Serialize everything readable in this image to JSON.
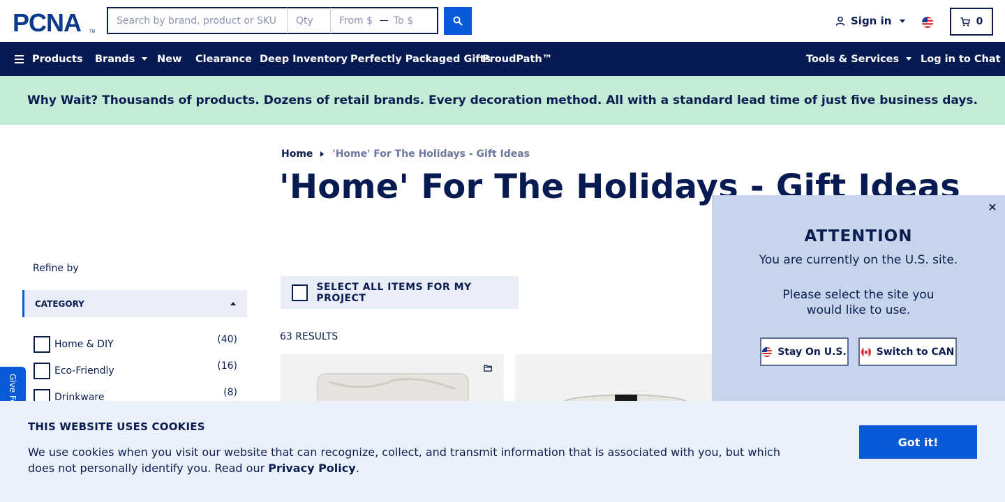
{
  "header": {
    "logo_text": "PCNA",
    "search_placeholder": "Search by brand, product or SKU",
    "qty_placeholder": "Qty",
    "price_from_placeholder": "From $",
    "price_to_placeholder": "To $",
    "sign_in_label": "Sign in",
    "cart_count": "0"
  },
  "nav": {
    "products": "Products",
    "brands": "Brands",
    "new": "New",
    "clearance": "Clearance",
    "deep_inventory": "Deep Inventory",
    "packaged_gifts": "Perfectly Packaged Gifts",
    "proudpath": "ProudPath™",
    "tools_services": "Tools & Services",
    "chat": "Log in to Chat"
  },
  "promo": {
    "lead": "Why Wait?",
    "text": " Thousands of products. Dozens of retail brands. Every decoration method. All with a standard lead time of just five business days."
  },
  "breadcrumb": {
    "home": "Home",
    "current": "'Home' For The Holidays - Gift Ideas"
  },
  "page_title": "'Home' For The Holidays - Gift Ideas",
  "sidebar": {
    "refine_label": "Refine by",
    "category_header": "CATEGORY",
    "facets": [
      {
        "label": "Home & DIY",
        "count": "(40)"
      },
      {
        "label": "Eco-Friendly",
        "count": "(16)"
      },
      {
        "label": "Drinkware",
        "count": "(8)"
      }
    ],
    "feedback_label": "Give Feedback"
  },
  "results": {
    "select_all_label": "SELECT ALL ITEMS FOR MY PROJECT",
    "count_label": "63 RESULTS"
  },
  "locale_popup": {
    "title": "ATTENTION",
    "subtitle": "You are currently on the U.S. site.",
    "message": "Please select the site you would like to use.",
    "stay_us": "Stay On U.S.",
    "switch_can": "Switch to CAN"
  },
  "cookie": {
    "title": "THIS WEBSITE USES COOKIES",
    "text": "We use cookies when you visit our website that can recognize, collect, and transmit information that is associated with you, but which does not personally identify you. Read our ",
    "link": "Privacy Policy",
    "period": ".",
    "button": "Got it!"
  },
  "colors": {
    "navy": "#071a52",
    "accent_blue": "#0a5ad8",
    "promo_green": "#c3ecd7",
    "popup_blue": "#c7d5ec",
    "cookie_bg": "#ebf1fb"
  },
  "icons": [
    "search-icon",
    "user-icon",
    "us-flag-icon",
    "cart-icon",
    "hamburger-icon",
    "close-icon",
    "folder-icon",
    "canada-flag-icon"
  ]
}
